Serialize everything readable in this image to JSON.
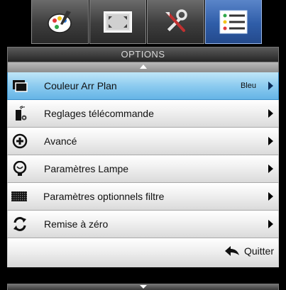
{
  "tabs": [
    {
      "icon": "palette-icon",
      "active": false
    },
    {
      "icon": "display-resize-icon",
      "active": false
    },
    {
      "icon": "tools-icon",
      "active": false
    },
    {
      "icon": "list-options-icon",
      "active": true
    }
  ],
  "header": {
    "title": "OPTIONS"
  },
  "menu": {
    "items": [
      {
        "label": "Couleur Arr Plan",
        "value": "Bleu",
        "icon": "background-color-icon",
        "selected": true
      },
      {
        "label": "Reglages télécommande",
        "value": "",
        "icon": "remote-settings-icon",
        "selected": false
      },
      {
        "label": "Avancé",
        "value": "",
        "icon": "advanced-plus-icon",
        "selected": false
      },
      {
        "label": "Paramètres Lampe",
        "value": "",
        "icon": "lamp-icon",
        "selected": false
      },
      {
        "label": "Paramètres optionnels filtre",
        "value": "",
        "icon": "filter-icon",
        "selected": false
      },
      {
        "label": "Remise à zéro",
        "value": "",
        "icon": "reset-icon",
        "selected": false
      }
    ]
  },
  "footer": {
    "quit_label": "Quitter",
    "icon": "back-arrow-icon"
  },
  "colors": {
    "accent": "#65b4e6",
    "tab_active": "#2f5da8",
    "header_bg": "#262626"
  }
}
